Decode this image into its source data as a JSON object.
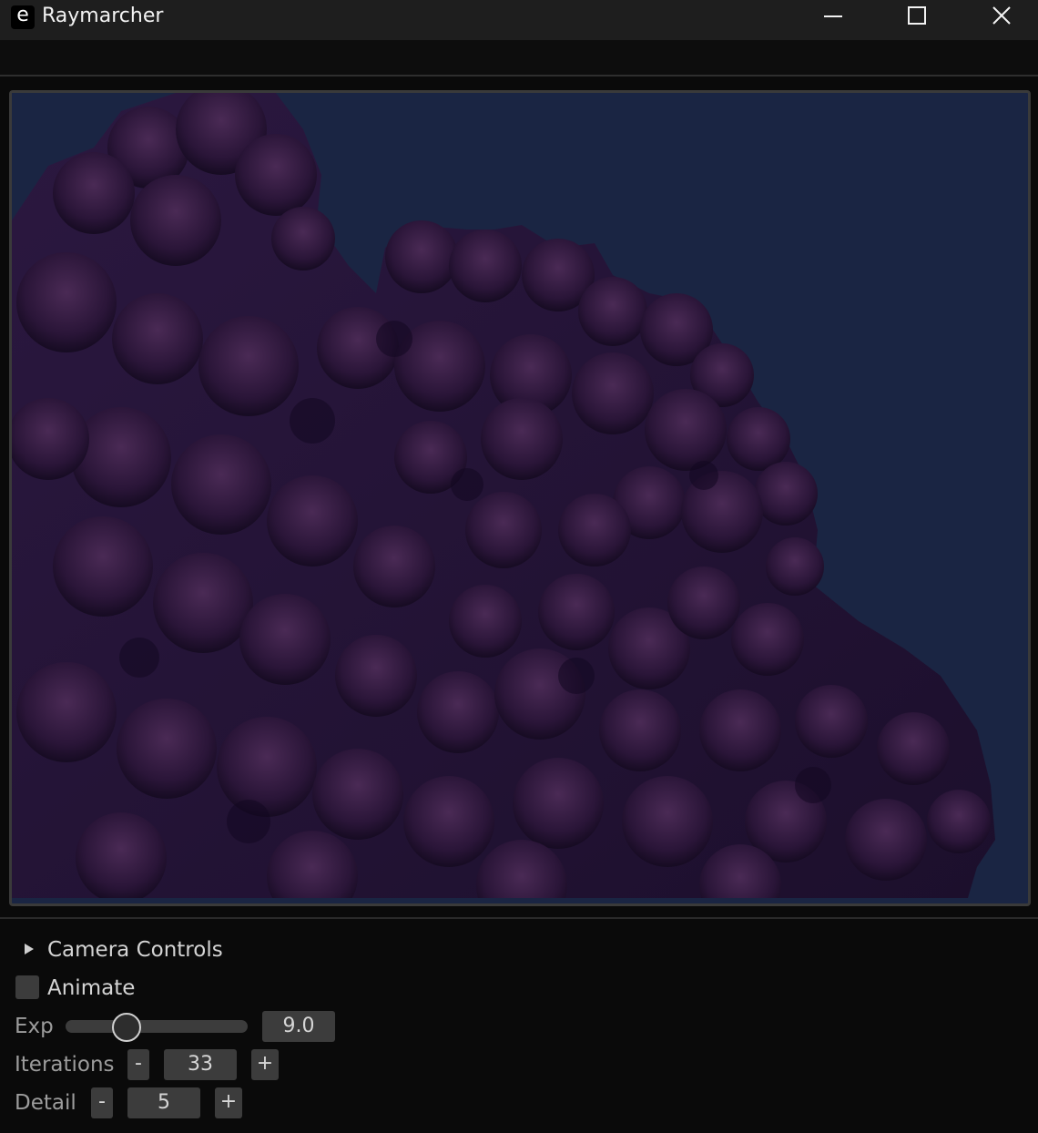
{
  "window": {
    "title": "Raymarcher",
    "app_icon_glyph": "e",
    "icons": [
      "minimize-icon",
      "maximize-icon",
      "close-icon"
    ]
  },
  "render_view": {
    "background_color": "#1a2543",
    "fractal_colors": [
      "#1d1030",
      "#2a1a45",
      "#3a2050"
    ]
  },
  "controls": {
    "camera_controls": {
      "label": "Camera Controls",
      "expanded": false
    },
    "animate": {
      "label": "Animate",
      "checked": false
    },
    "exp": {
      "label": "Exp",
      "value": "9.0",
      "slider_fraction": 0.33
    },
    "iterations": {
      "label": "Iterations",
      "minus": "-",
      "value": "33",
      "plus": "+"
    },
    "detail": {
      "label": "Detail",
      "minus": "-",
      "value": "5",
      "plus": "+"
    }
  }
}
